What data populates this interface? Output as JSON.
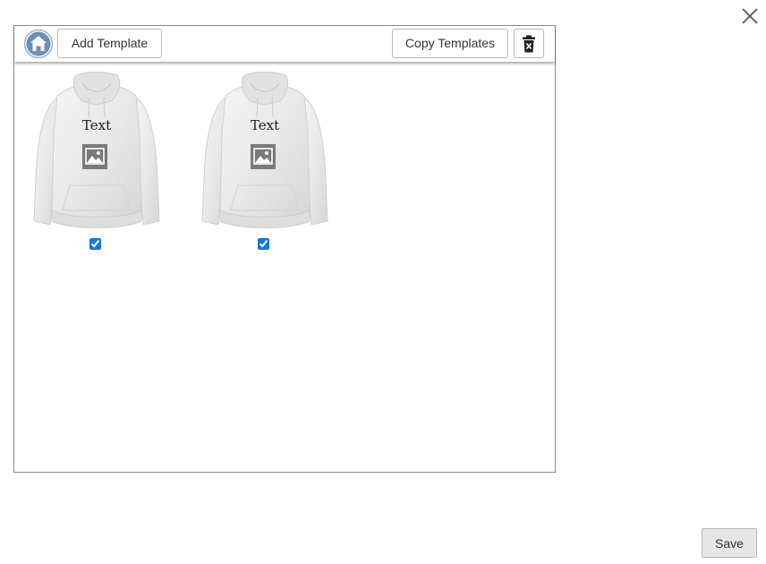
{
  "dialog": {
    "close_icon": "close-icon"
  },
  "toolbar": {
    "home_icon": "home-icon",
    "add_label": "Add Template",
    "copy_label": "Copy Templates",
    "delete_icon": "trash-icon"
  },
  "templates": [
    {
      "text": "Text",
      "image_icon": "image-icon",
      "checked": true
    },
    {
      "text": "Text",
      "image_icon": "image-icon",
      "checked": true
    }
  ],
  "footer": {
    "save_label": "Save"
  },
  "colors": {
    "home_icon_bg": "#6d8fb5",
    "checkbox_accent": "#1a73e8",
    "save_bg": "#e6e6e6"
  }
}
